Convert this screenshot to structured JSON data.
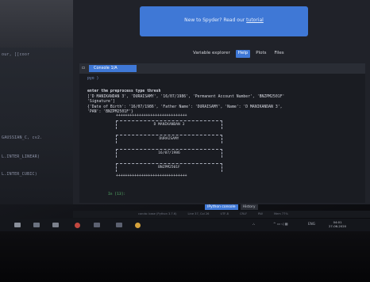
{
  "editor": {
    "lines": [
      "our, [[coor",
      "GAUSSIAN_C, cv2.",
      "L.INTER_LINEAR)",
      "L.INTER_CUBIC)"
    ]
  },
  "tour_banner": {
    "text": "New to Spyder? Read our",
    "link": "tutorial"
  },
  "top_tabs": [
    "Variable explorer",
    "Help",
    "Plots",
    "Files"
  ],
  "console": {
    "tab_label": "Console 1/A",
    "lines": [
      "pyo )",
      "enter the preprocess type thresh",
      "['D MANIKANDAN 3', 'DURAISAMY', '16/07/1986', 'Permanent Account Number', 'BNZPM2501F'",
      " 'Signature']",
      " {'Date of Birth': '16/07/1986', 'Father Name': 'DURAISAMY', 'Name': 'D MANIKANDAN 3',",
      " 'PAN': 'BNZPM2501F'}"
    ],
    "table_border": "+++++++++++++++++++++++++++++++",
    "table_rows": [
      "D MANIKANDAN 3",
      "DURAISAMY",
      "16/07/1986",
      "BNZPM2501F"
    ],
    "input_prompt": "In [13]:"
  },
  "panel_tabs": [
    "IPython console",
    "History"
  ],
  "statusbar": [
    "conda: base (Python 3.7.6)",
    "Line 37, Col 26",
    "UTF-8",
    "CRLF",
    "RW",
    "Mem 77%"
  ],
  "taskbar": {
    "tray_text": "ENG",
    "time": "04:01",
    "date": "27-06-2020"
  }
}
